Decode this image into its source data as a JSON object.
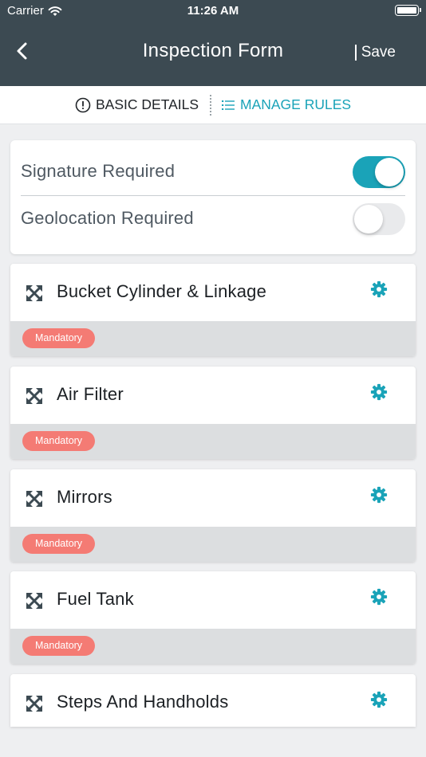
{
  "status_bar": {
    "carrier": "Carrier",
    "time": "11:26 AM"
  },
  "nav": {
    "title": "Inspection Form",
    "save_label": "Save"
  },
  "tabs": [
    {
      "label": "BASIC DETAILS",
      "icon": "info-circle-icon",
      "active": false
    },
    {
      "label": "MANAGE RULES",
      "icon": "list-icon",
      "active": true
    }
  ],
  "settings": {
    "signature_required": {
      "label": "Signature Required",
      "on": true
    },
    "geolocation_required": {
      "label": "Geolocation Required",
      "on": false
    }
  },
  "rules": [
    {
      "name": "Bucket Cylinder & Linkage",
      "badge": "Mandatory"
    },
    {
      "name": "Air Filter",
      "badge": "Mandatory"
    },
    {
      "name": "Mirrors",
      "badge": "Mandatory"
    },
    {
      "name": "Fuel Tank",
      "badge": "Mandatory"
    },
    {
      "name": "Steps And Handholds"
    }
  ],
  "colors": {
    "header": "#3c4a52",
    "accent": "#1aa3b8",
    "badge": "#f47b74",
    "icon": "#3c4a52"
  }
}
